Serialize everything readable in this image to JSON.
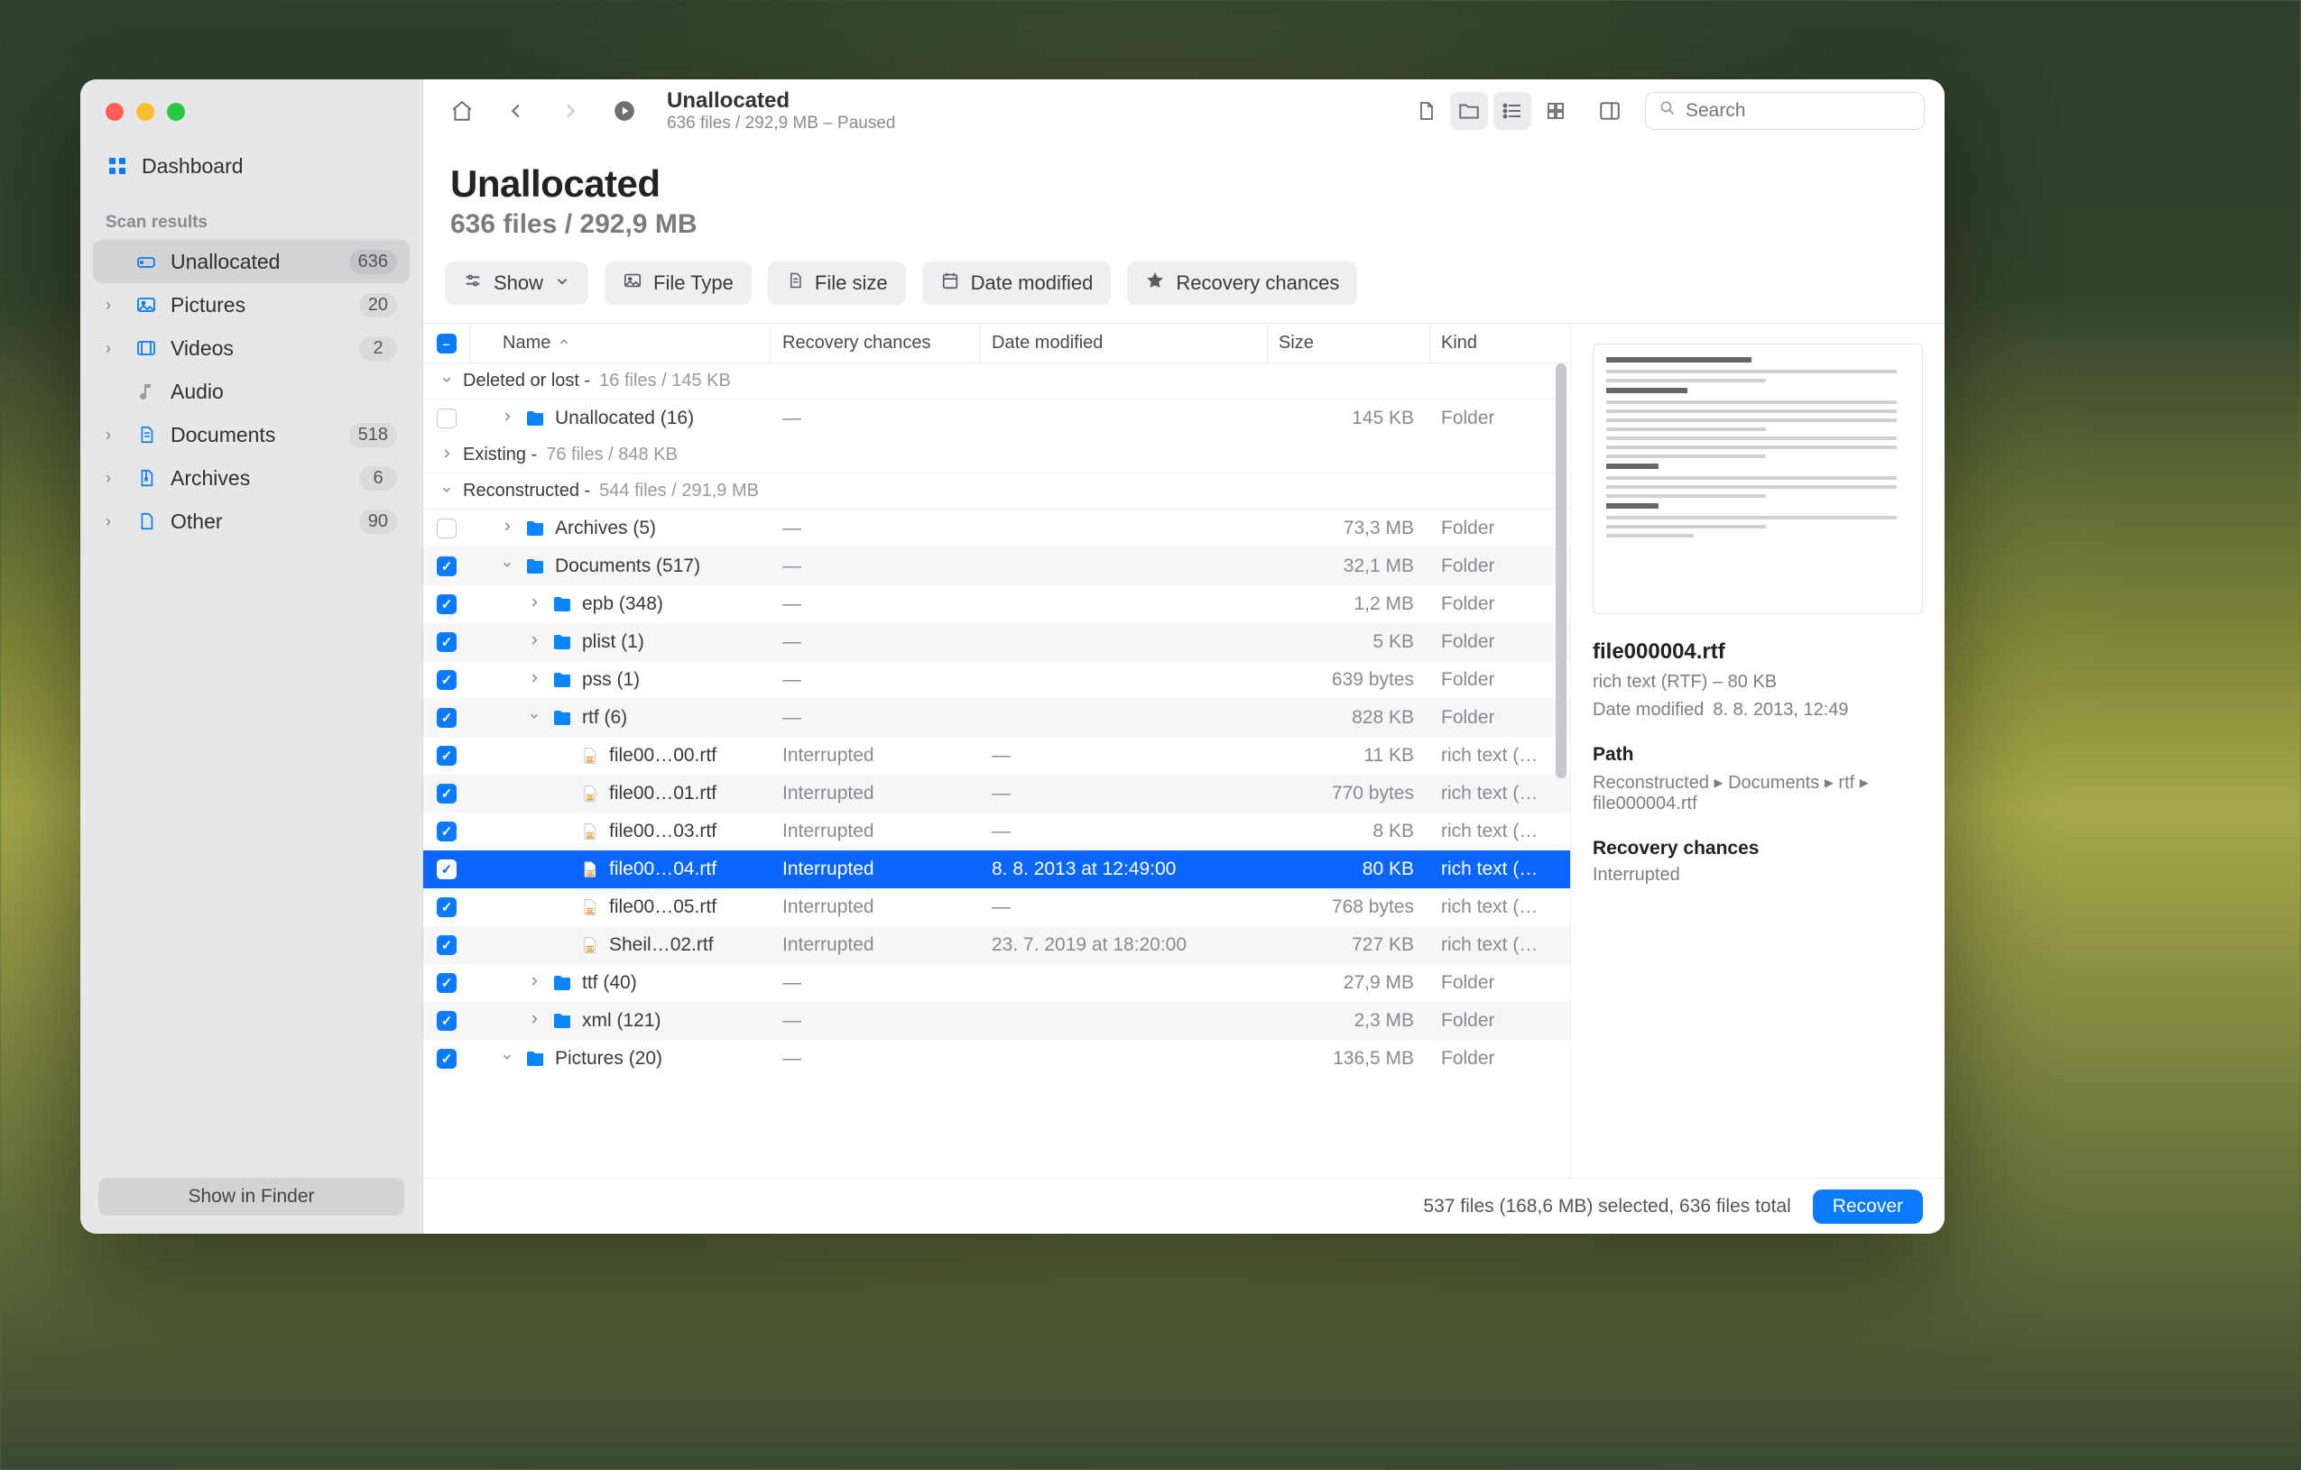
{
  "sidebar": {
    "dashboard": "Dashboard",
    "section_label": "Scan results",
    "items": [
      {
        "name": "Unallocated",
        "count": "636",
        "icon": "disk",
        "chev": false,
        "active": true
      },
      {
        "name": "Pictures",
        "count": "20",
        "icon": "picture",
        "chev": true
      },
      {
        "name": "Videos",
        "count": "2",
        "icon": "video",
        "chev": true
      },
      {
        "name": "Audio",
        "count": "",
        "icon": "audio",
        "chev": false,
        "muted": true
      },
      {
        "name": "Documents",
        "count": "518",
        "icon": "document",
        "chev": true
      },
      {
        "name": "Archives",
        "count": "6",
        "icon": "archive",
        "chev": true
      },
      {
        "name": "Other",
        "count": "90",
        "icon": "other",
        "chev": true
      }
    ],
    "footer_button": "Show in Finder"
  },
  "toolbar": {
    "title": "Unallocated",
    "subtitle": "636 files / 292,9 MB – Paused",
    "search_placeholder": "Search"
  },
  "header": {
    "title": "Unallocated",
    "subtitle": "636 files / 292,9 MB"
  },
  "filters": {
    "show": "Show",
    "file_type": "File Type",
    "file_size": "File size",
    "date_modified": "Date modified",
    "recovery_chances": "Recovery chances"
  },
  "columns": {
    "name": "Name",
    "recovery": "Recovery chances",
    "date": "Date modified",
    "size": "Size",
    "kind": "Kind"
  },
  "groups": [
    {
      "label": "Deleted or lost",
      "meta": "16 files / 145 KB",
      "open": true
    },
    {
      "label": "Existing",
      "meta": "76 files / 848 KB",
      "open": false
    },
    {
      "label": "Reconstructed",
      "meta": "544 files / 291,9 MB",
      "open": true
    }
  ],
  "rows": [
    {
      "hdr": "Deleted or lost"
    },
    {
      "cb": false,
      "indent": 1,
      "chev": "r",
      "icon": "folder",
      "name": "Unallocated (16)",
      "rc": "—",
      "dm": "",
      "sz": "145 KB",
      "kd": "Folder"
    },
    {
      "hdr": "Existing"
    },
    {
      "hdr": "Reconstructed"
    },
    {
      "cb": false,
      "indent": 1,
      "chev": "r",
      "icon": "folder",
      "name": "Archives (5)",
      "rc": "—",
      "dm": "",
      "sz": "73,3 MB",
      "kd": "Folder"
    },
    {
      "cb": true,
      "indent": 1,
      "chev": "d",
      "icon": "folder",
      "name": "Documents (517)",
      "rc": "—",
      "dm": "",
      "sz": "32,1 MB",
      "kd": "Folder",
      "striped": true
    },
    {
      "cb": true,
      "indent": 2,
      "chev": "r",
      "icon": "folder",
      "name": "epb (348)",
      "rc": "—",
      "dm": "",
      "sz": "1,2 MB",
      "kd": "Folder"
    },
    {
      "cb": true,
      "indent": 2,
      "chev": "r",
      "icon": "folder",
      "name": "plist (1)",
      "rc": "—",
      "dm": "",
      "sz": "5 KB",
      "kd": "Folder",
      "striped": true
    },
    {
      "cb": true,
      "indent": 2,
      "chev": "r",
      "icon": "folder",
      "name": "pss (1)",
      "rc": "—",
      "dm": "",
      "sz": "639 bytes",
      "kd": "Folder"
    },
    {
      "cb": true,
      "indent": 2,
      "chev": "d",
      "icon": "folder",
      "name": "rtf (6)",
      "rc": "—",
      "dm": "",
      "sz": "828 KB",
      "kd": "Folder",
      "striped": true
    },
    {
      "cb": true,
      "indent": 3,
      "chev": "",
      "icon": "rtf",
      "name": "file00…00.rtf",
      "rc": "Interrupted",
      "dm": "",
      "sz": "11 KB",
      "kd": "rich text (…"
    },
    {
      "cb": true,
      "indent": 3,
      "chev": "",
      "icon": "rtf",
      "name": "file00…01.rtf",
      "rc": "Interrupted",
      "dm": "",
      "sz": "770 bytes",
      "kd": "rich text (…",
      "striped": true
    },
    {
      "cb": true,
      "indent": 3,
      "chev": "",
      "icon": "rtf",
      "name": "file00…03.rtf",
      "rc": "Interrupted",
      "dm": "",
      "sz": "8 KB",
      "kd": "rich text (…"
    },
    {
      "cb": true,
      "indent": 3,
      "chev": "",
      "icon": "rtf",
      "name": "file00…04.rtf",
      "rc": "Interrupted",
      "dm": "8. 8. 2013 at 12:49:00",
      "sz": "80 KB",
      "kd": "rich text (…",
      "selected": true
    },
    {
      "cb": true,
      "indent": 3,
      "chev": "",
      "icon": "rtf",
      "name": "file00…05.rtf",
      "rc": "Interrupted",
      "dm": "",
      "sz": "768 bytes",
      "kd": "rich text (…"
    },
    {
      "cb": true,
      "indent": 3,
      "chev": "",
      "icon": "rtf",
      "name": "Sheil…02.rtf",
      "rc": "Interrupted",
      "dm": "23. 7. 2019 at 18:20:00",
      "sz": "727 KB",
      "kd": "rich text (…",
      "striped": true
    },
    {
      "cb": true,
      "indent": 2,
      "chev": "r",
      "icon": "folder",
      "name": "ttf (40)",
      "rc": "—",
      "dm": "",
      "sz": "27,9 MB",
      "kd": "Folder"
    },
    {
      "cb": true,
      "indent": 2,
      "chev": "r",
      "icon": "folder",
      "name": "xml (121)",
      "rc": "—",
      "dm": "",
      "sz": "2,3 MB",
      "kd": "Folder",
      "striped": true
    },
    {
      "cb": true,
      "indent": 1,
      "chev": "d",
      "icon": "folder",
      "name": "Pictures (20)",
      "rc": "—",
      "dm": "",
      "sz": "136,5 MB",
      "kd": "Folder"
    }
  ],
  "detail": {
    "filename": "file000004.rtf",
    "type_size": "rich text (RTF) – 80 KB",
    "date_label": "Date modified",
    "date_value": "8. 8. 2013, 12:49",
    "path_label": "Path",
    "path_value": "Reconstructed ▸ Documents ▸ rtf ▸ file000004.rtf",
    "rc_label": "Recovery chances",
    "rc_value": "Interrupted"
  },
  "footer": {
    "status": "537 files (168,6 MB) selected, 636 files total",
    "recover": "Recover"
  }
}
